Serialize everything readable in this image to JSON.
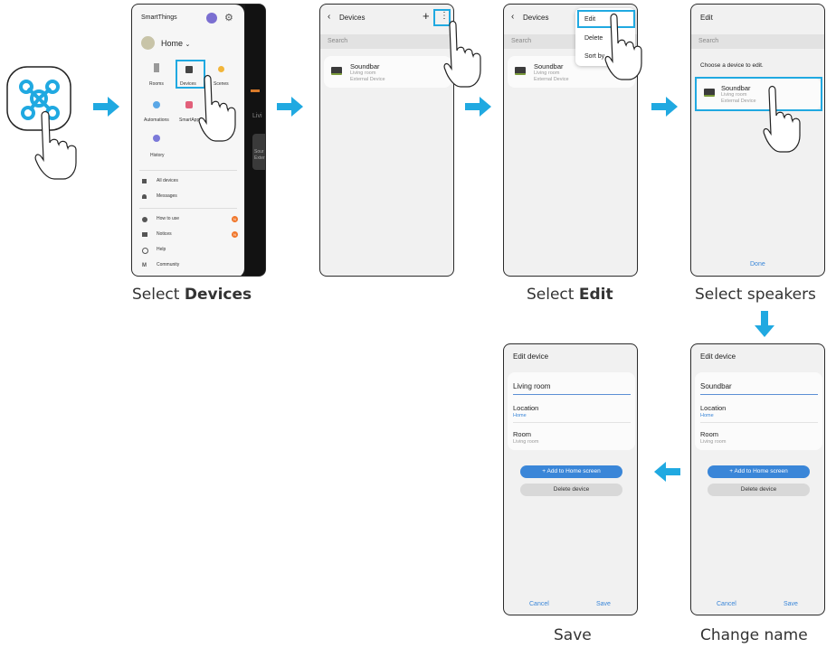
{
  "captions": {
    "step1": [
      "Select ",
      "Devices"
    ],
    "step3": [
      "Select ",
      "Edit"
    ],
    "step4": "Select speakers",
    "step5": "Change name",
    "step6": "Save"
  },
  "panel1": {
    "app_title": "SmartThings",
    "location": "Home",
    "tiles": [
      "Rooms",
      "Devices",
      "Scenes",
      "Automations",
      "SmartApps",
      "History"
    ],
    "menu": [
      "All devices",
      "Messages",
      "How to use",
      "Notices",
      "Help",
      "Community"
    ],
    "badges": [
      "N",
      "N"
    ],
    "peek_text": [
      "Livi",
      "Sour",
      "Exter"
    ]
  },
  "devices_list": {
    "title": "Devices",
    "search_placeholder": "Search",
    "device_name": "Soundbar",
    "device_room": "Living room",
    "device_type": "External Device",
    "add_icon": "+",
    "more_icon": "⋮"
  },
  "menu_popup": {
    "items": [
      "Edit",
      "Delete",
      "Sort by"
    ]
  },
  "edit_screen": {
    "title": "Edit",
    "search_placeholder": "Search",
    "instruction": "Choose a device to edit.",
    "device_name": "Soundbar",
    "device_room": "Living room",
    "device_type": "External Device",
    "done": "Done"
  },
  "edit_device_a": {
    "title": "Edit device",
    "name_value": "Soundbar",
    "location_label": "Location",
    "location_value": "Home",
    "room_label": "Room",
    "room_value": "Living room",
    "add_home": "+  Add to Home screen",
    "delete": "Delete device",
    "cancel": "Cancel",
    "save": "Save"
  },
  "edit_device_b": {
    "title": "Edit device",
    "name_value": "Living room",
    "location_label": "Location",
    "location_value": "Home",
    "room_label": "Room",
    "room_value": "Living room",
    "add_home": "+  Add to Home screen",
    "delete": "Delete device",
    "cancel": "Cancel",
    "save": "Save"
  },
  "colors": {
    "accent": "#20a9e1",
    "link_blue": "#3a86d8",
    "phone_bg": "#f1f1f1"
  }
}
